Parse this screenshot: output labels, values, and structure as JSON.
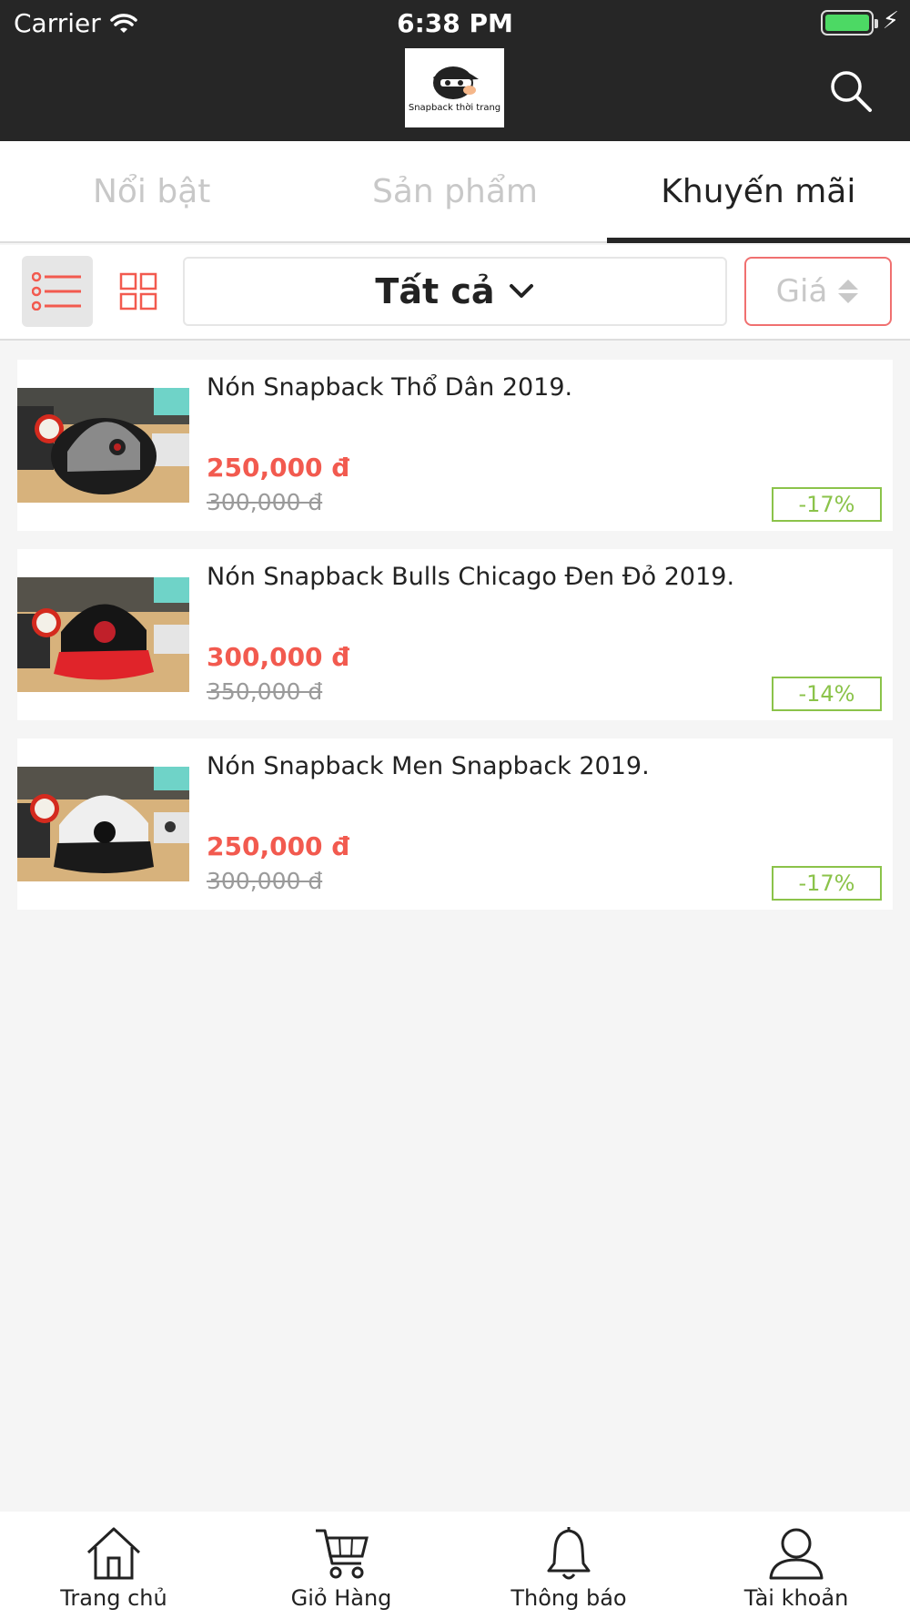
{
  "status_bar": {
    "carrier": "Carrier",
    "time": "6:38 PM"
  },
  "header": {
    "logo_text": "Snapback thời trang",
    "search_icon": "search-icon"
  },
  "tabs": [
    {
      "label": "Nổi bật",
      "active": false
    },
    {
      "label": "Sản phẩm",
      "active": false
    },
    {
      "label": "Khuyến mãi",
      "active": true
    }
  ],
  "toolbar": {
    "filter_label": "Tất cả",
    "sort_label": "Giá",
    "accent": "#f25a4f"
  },
  "products": [
    {
      "name": "Nón Snapback Thổ Dân 2019.",
      "price": "250,000 đ",
      "old_price": "300,000 đ",
      "discount": "-17%",
      "image": "gray-cap-photo"
    },
    {
      "name": "Nón Snapback Bulls Chicago Đen Đỏ 2019.",
      "price": "300,000 đ",
      "old_price": "350,000 đ",
      "discount": "-14%",
      "image": "black-red-cap-photo"
    },
    {
      "name": "Nón Snapback Men Snapback 2019.",
      "price": "250,000 đ",
      "old_price": "300,000 đ",
      "discount": "-17%",
      "image": "white-black-cap-photo"
    }
  ],
  "bottom_nav": [
    {
      "label": "Trang chủ",
      "icon": "home-icon"
    },
    {
      "label": "Giỏ Hàng",
      "icon": "cart-icon"
    },
    {
      "label": "Thông báo",
      "icon": "bell-icon"
    },
    {
      "label": "Tài khoản",
      "icon": "user-icon"
    }
  ],
  "colors": {
    "header_bg": "#262626",
    "price": "#f25a4f",
    "discount": "#8bc34a",
    "sort_border": "#f07070"
  }
}
